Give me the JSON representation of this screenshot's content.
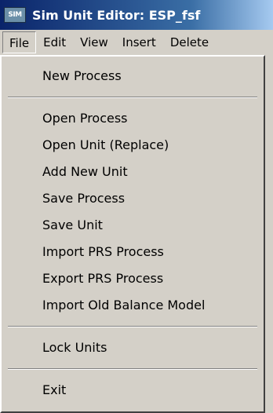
{
  "window": {
    "title": "Sim Unit Editor: ESP_fsf",
    "icon_text": "SIM"
  },
  "menubar": {
    "items": [
      "File",
      "Edit",
      "View",
      "Insert",
      "Delete"
    ]
  },
  "file_menu": {
    "new_process": "New Process",
    "open_process": "Open Process",
    "open_unit_replace": "Open Unit (Replace)",
    "add_new_unit": "Add New Unit",
    "save_process": "Save Process",
    "save_unit": "Save Unit",
    "import_prs_process": "Import PRS Process",
    "export_prs_process": "Export PRS Process",
    "import_old_balance_model": "Import Old Balance Model",
    "lock_units": "Lock Units",
    "exit": "Exit"
  }
}
